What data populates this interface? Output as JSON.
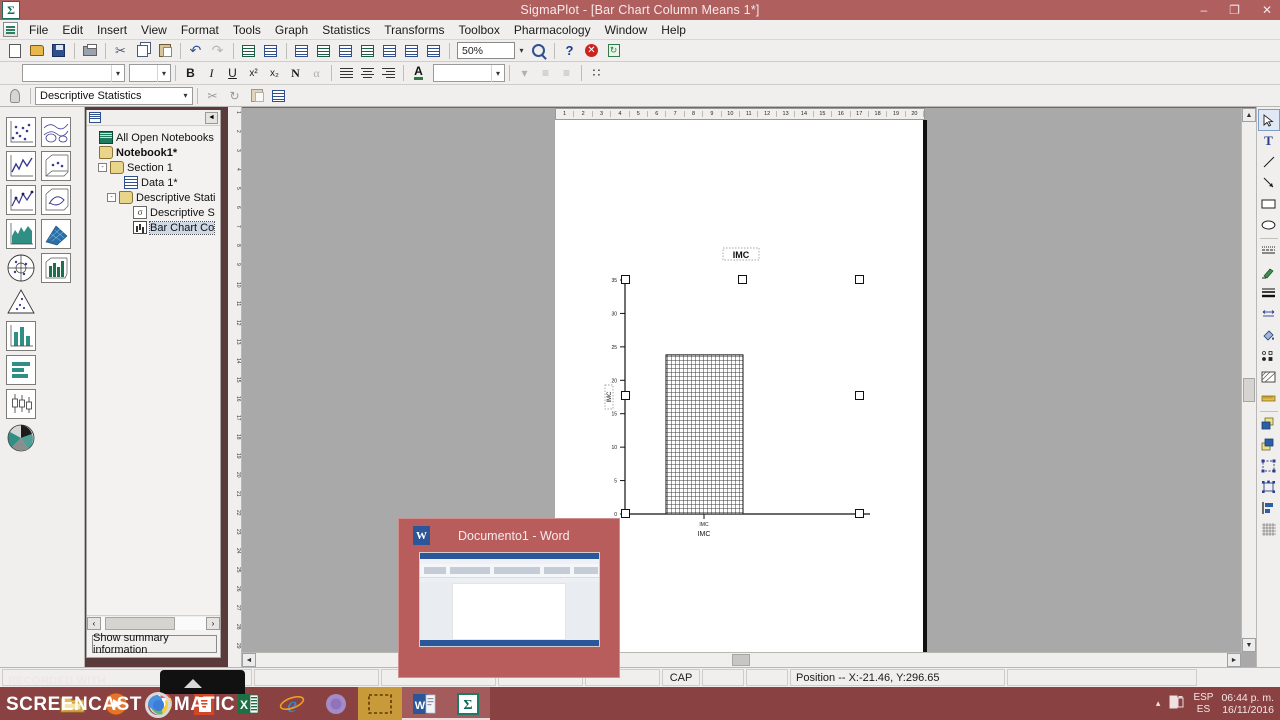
{
  "window": {
    "title": "SigmaPlot - [Bar Chart Column Means 1*]",
    "app_icon": "sigma-icon",
    "minimize": "–",
    "maximize": "❐",
    "close": "✕",
    "mdi_minimize": "–",
    "mdi_restore": "❐",
    "mdi_close": "✕"
  },
  "menubar": {
    "items": [
      "File",
      "Edit",
      "Insert",
      "View",
      "Format",
      "Tools",
      "Graph",
      "Statistics",
      "Transforms",
      "Toolbox",
      "Pharmacology",
      "Window",
      "Help"
    ]
  },
  "toolbar_standard": {
    "buttons": [
      {
        "name": "new-notebook-button",
        "tip": "New"
      },
      {
        "name": "open-button",
        "tip": "Open"
      },
      {
        "name": "save-button",
        "tip": "Save"
      },
      {
        "name": "print-button",
        "tip": "Print"
      },
      {
        "name": "cut-button",
        "tip": "Cut"
      },
      {
        "name": "copy-button",
        "tip": "Copy"
      },
      {
        "name": "paste-button",
        "tip": "Paste"
      },
      {
        "name": "undo-button",
        "tip": "Undo"
      },
      {
        "name": "redo-button",
        "tip": "Redo"
      },
      {
        "name": "worksheet-button",
        "tip": "New Worksheet"
      },
      {
        "name": "graph-page-button",
        "tip": "New Graph Page"
      },
      {
        "name": "graph-wizard-button",
        "tip": "Graph Wizard"
      },
      {
        "name": "data-table-button",
        "tip": "Data Table"
      },
      {
        "name": "graph-properties-button",
        "tip": "Graph Properties"
      },
      {
        "name": "report-button",
        "tip": "Report"
      },
      {
        "name": "notebook-manager-button",
        "tip": "Notebook Manager"
      },
      {
        "name": "regression-wizard-button",
        "tip": "Regression Wizard"
      },
      {
        "name": "page-layout-button",
        "tip": "Page Layout"
      }
    ],
    "zoom_value": "50%",
    "zoom_dropdown_arrow": "▾",
    "magnifier_icon": "magnifier-icon",
    "help_icon": "?",
    "stop_icon": "✕",
    "refresh_icon": "↻"
  },
  "toolbar_format": {
    "font_name": "",
    "font_size": "",
    "bold": "B",
    "italic": "I",
    "underline": "U",
    "superscript": "x²",
    "subscript": "x₂",
    "symbol": "N",
    "greek": "α",
    "align_left": "align-left",
    "align_center": "align-center",
    "align_right": "align-right",
    "text_color": "A",
    "color_value": "",
    "dropdown_arrow": "▾"
  },
  "toolbar_statistics": {
    "bulb_icon": "lightbulb-icon",
    "test_selector_value": "Descriptive Statistics",
    "dropdown_arrow": "▾",
    "buttons": [
      {
        "name": "run-test-button"
      },
      {
        "name": "rerun-button"
      },
      {
        "name": "report-options-button"
      },
      {
        "name": "create-graph-button"
      }
    ]
  },
  "graph_palette": {
    "column1": [
      "scatter-plot-icon",
      "line-plot-icon",
      "line-and-scatter-icon",
      "area-plot-icon",
      "polar-plot-icon",
      "ternary-plot-icon",
      "vertical-bar-chart-icon",
      "horizontal-bar-chart-icon",
      "box-plot-icon",
      "pie-chart-icon"
    ],
    "column2": [
      "contour-plot-icon",
      "three-d-scatter-icon",
      "three-d-line-icon",
      "three-d-mesh-icon",
      "three-d-bar-icon"
    ]
  },
  "navigator": {
    "header_icon": "notebook-view-icon",
    "collapse_arrow": "◄",
    "tree": [
      {
        "label": "All Open Notebooks",
        "icon": "all-notebooks-icon",
        "depth": 0,
        "expander": "",
        "bold": false,
        "selected": false
      },
      {
        "label": "Notebook1*",
        "icon": "notebook-icon",
        "depth": 0,
        "expander": "",
        "bold": true,
        "selected": false
      },
      {
        "label": "Section 1",
        "icon": "section-icon",
        "depth": 1,
        "expander": "-",
        "bold": false,
        "selected": false
      },
      {
        "label": "Data 1*",
        "icon": "worksheet-icon",
        "depth": 2,
        "expander": "",
        "bold": false,
        "selected": false
      },
      {
        "label": "Descriptive Stati",
        "icon": "section-icon",
        "depth": 2,
        "expander": "-",
        "bold": false,
        "selected": false
      },
      {
        "label": "Descriptive S",
        "icon": "report-icon",
        "depth": 3,
        "expander": "",
        "bold": false,
        "selected": false
      },
      {
        "label": "Bar Chart Co",
        "icon": "graph-icon",
        "depth": 3,
        "expander": "",
        "bold": false,
        "selected": true
      }
    ],
    "scroll_left_arrow": "‹",
    "scroll_right_arrow": "›",
    "summary_button": "Show summary information"
  },
  "rulers": {
    "horizontal_marks": [
      "1",
      "2",
      "3",
      "4",
      "5",
      "6",
      "7",
      "8",
      "9",
      "10",
      "11",
      "12",
      "13",
      "14",
      "15",
      "16",
      "17",
      "18",
      "19",
      "20"
    ],
    "vertical_marks": [
      "1",
      "2",
      "3",
      "4",
      "5",
      "6",
      "7",
      "8",
      "9",
      "10",
      "11",
      "12",
      "13",
      "14",
      "15",
      "16",
      "17",
      "18",
      "19",
      "20",
      "21",
      "22",
      "23",
      "24",
      "25",
      "26",
      "27",
      "28",
      "29"
    ]
  },
  "chart_data": {
    "type": "bar",
    "title": "IMC",
    "xlabel": "IMC",
    "ylabel": "IMC",
    "categories": [
      "IMC"
    ],
    "values": [
      23.8
    ],
    "tick_labels_y": [
      "0",
      "5",
      "10",
      "15",
      "20",
      "25",
      "30",
      "35"
    ],
    "ytick_values": [
      0,
      5,
      10,
      15,
      20,
      25,
      30,
      35
    ],
    "ylim": [
      0,
      35
    ],
    "grid": false,
    "legend": "none",
    "bar_fill": "crosshatch",
    "bar_fill_color": "#555555",
    "axis_color": "#000000",
    "selected": true,
    "tick_label_x": "IMC"
  },
  "selection_handles": {
    "count": 8,
    "color": "#ffffff",
    "border": "#111111"
  },
  "workspace_scroll": {
    "v_up_arrow": "▲",
    "v_down_arrow": "▼",
    "h_left_arrow": "◄",
    "h_right_arrow": "►"
  },
  "drawing_toolbar": {
    "tools": [
      "pointer-icon",
      "text-tool-icon",
      "line-tool-icon",
      "arrow-tool-icon",
      "rectangle-tool-icon",
      "ellipse-tool-icon",
      "line-style-icon",
      "line-color-icon",
      "line-thickness-icon",
      "line-length-icon",
      "fill-color-icon",
      "symbol-style-icon",
      "fill-pattern-icon",
      "ruler-icon",
      "bring-to-front-icon",
      "send-to-back-icon",
      "group-icon",
      "ungroup-icon",
      "align-objects-icon",
      "grid-snap-icon"
    ]
  },
  "statusbar": {
    "caps_indicator": "CAP",
    "position_text": "Position -- X:-21.46, Y:296.65"
  },
  "taskbar": {
    "items": [
      {
        "name": "file-explorer",
        "icon": "folder-icon"
      },
      {
        "name": "media-player",
        "icon": "media-player-icon"
      },
      {
        "name": "chrome",
        "icon": "chrome-icon"
      },
      {
        "name": "powerpoint",
        "icon": "powerpoint-icon"
      },
      {
        "name": "excel",
        "icon": "excel-icon"
      },
      {
        "name": "internet-explorer",
        "icon": "ie-icon"
      },
      {
        "name": "firefox",
        "icon": "browser-icon"
      },
      {
        "name": "snipping-tool",
        "icon": "snip-icon"
      },
      {
        "name": "word",
        "icon": "word-icon"
      },
      {
        "name": "sigmaplot",
        "icon": "sigma-icon"
      }
    ],
    "tray_show_hidden": "▴",
    "tray_battery": "battery-icon",
    "language_primary": "ESP",
    "language_secondary": "ES",
    "clock_time": "06:44 p. m.",
    "clock_date": "16/11/2016"
  },
  "thumbnail_popup": {
    "app_icon": "word-icon",
    "title": "Documento1 - Word"
  },
  "watermark": {
    "recorded_with": "RECORDED WITH",
    "brand_first": "SCREENCAST",
    "brand_second": "MATIC"
  },
  "colors": {
    "titlebar": "#b05f5f",
    "taskbar": "#8a4141",
    "toolbar": "#f0efed",
    "workspace": "#a9a9a9",
    "page": "#ffffff",
    "accent_word": "#2b579a",
    "accent_sigma": "#0b6b57"
  }
}
